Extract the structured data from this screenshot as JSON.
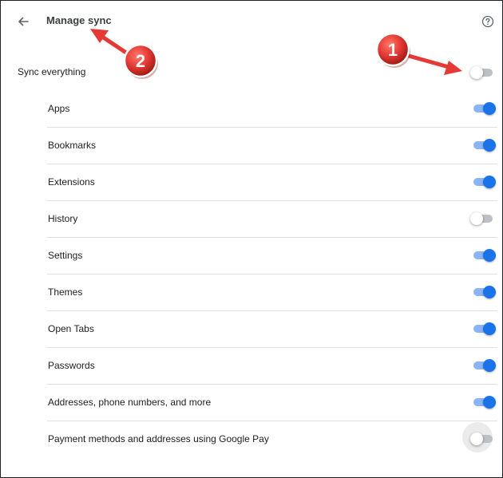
{
  "header": {
    "title": "Manage sync",
    "back_icon": "arrow-back-icon",
    "help_icon": "help-icon"
  },
  "sync_everything": {
    "label": "Sync everything",
    "enabled": false
  },
  "items": [
    {
      "label": "Apps",
      "enabled": true
    },
    {
      "label": "Bookmarks",
      "enabled": true
    },
    {
      "label": "Extensions",
      "enabled": true
    },
    {
      "label": "History",
      "enabled": false
    },
    {
      "label": "Settings",
      "enabled": true
    },
    {
      "label": "Themes",
      "enabled": true
    },
    {
      "label": "Open Tabs",
      "enabled": true
    },
    {
      "label": "Passwords",
      "enabled": true
    },
    {
      "label": "Addresses, phone numbers, and more",
      "enabled": true
    },
    {
      "label": "Payment methods and addresses using Google Pay",
      "enabled": false
    }
  ],
  "annotations": [
    {
      "number": "1",
      "target": "sync-everything-toggle"
    },
    {
      "number": "2",
      "target": "page-title"
    }
  ],
  "colors": {
    "accent": "#1a73e8",
    "accent_track": "#8ab4f8",
    "off_track": "#bdc1c6",
    "annotation_red": "#e53935"
  }
}
